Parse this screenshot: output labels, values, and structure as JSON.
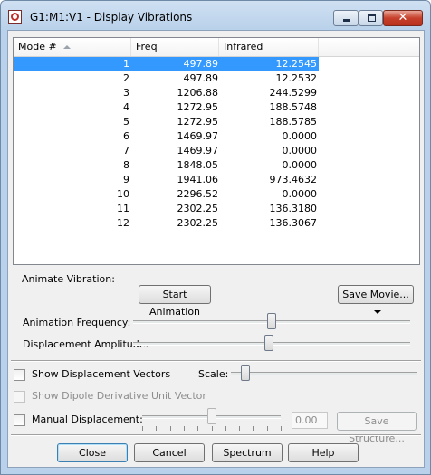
{
  "window": {
    "title": "G1:M1:V1 - Display Vibrations",
    "buttons": {
      "close_glyph": "✕"
    }
  },
  "table": {
    "columns": [
      "Mode #",
      "Freq",
      "Infrared"
    ],
    "rows": [
      {
        "mode": "1",
        "freq": "497.89",
        "ir": "12.2545"
      },
      {
        "mode": "2",
        "freq": "497.89",
        "ir": "12.2532"
      },
      {
        "mode": "3",
        "freq": "1206.88",
        "ir": "244.5299"
      },
      {
        "mode": "4",
        "freq": "1272.95",
        "ir": "188.5748"
      },
      {
        "mode": "5",
        "freq": "1272.95",
        "ir": "188.5785"
      },
      {
        "mode": "6",
        "freq": "1469.97",
        "ir": "0.0000"
      },
      {
        "mode": "7",
        "freq": "1469.97",
        "ir": "0.0000"
      },
      {
        "mode": "8",
        "freq": "1848.05",
        "ir": "0.0000"
      },
      {
        "mode": "9",
        "freq": "1941.06",
        "ir": "973.4632"
      },
      {
        "mode": "10",
        "freq": "2296.52",
        "ir": "0.0000"
      },
      {
        "mode": "11",
        "freq": "2302.25",
        "ir": "136.3180"
      },
      {
        "mode": "12",
        "freq": "2302.25",
        "ir": "136.3067"
      }
    ],
    "selected_row": 0,
    "selection_color": "#3399ff"
  },
  "animate": {
    "label": "Animate Vibration:",
    "start_button": "Start Animation",
    "save_movie_button": "Save Movie...",
    "frequency_label": "Animation Frequency:",
    "frequency_level": 0.5,
    "amplitude_label": "Displacement Amplitude:",
    "amplitude_level": 0.49
  },
  "options": {
    "show_vectors_label": "Show Displacement Vectors",
    "show_vectors_checked": false,
    "scale_label": "Scale:",
    "scale_level": 0.08,
    "dipole_label": "Show Dipole Derivative Unit Vector",
    "dipole_checked": false,
    "manual_label": "Manual Displacement:",
    "manual_checked": false,
    "manual_level": 0.5,
    "manual_value": "0.00",
    "save_structure_button": "Save Structure..."
  },
  "footer": {
    "close": "Close",
    "cancel": "Cancel",
    "spectrum": "Spectrum",
    "help": "Help"
  },
  "icons": [
    "app-icon",
    "sort-ascending-icon",
    "minimize-icon",
    "maximize-icon",
    "close-icon",
    "dropdown-arrow-icon"
  ]
}
